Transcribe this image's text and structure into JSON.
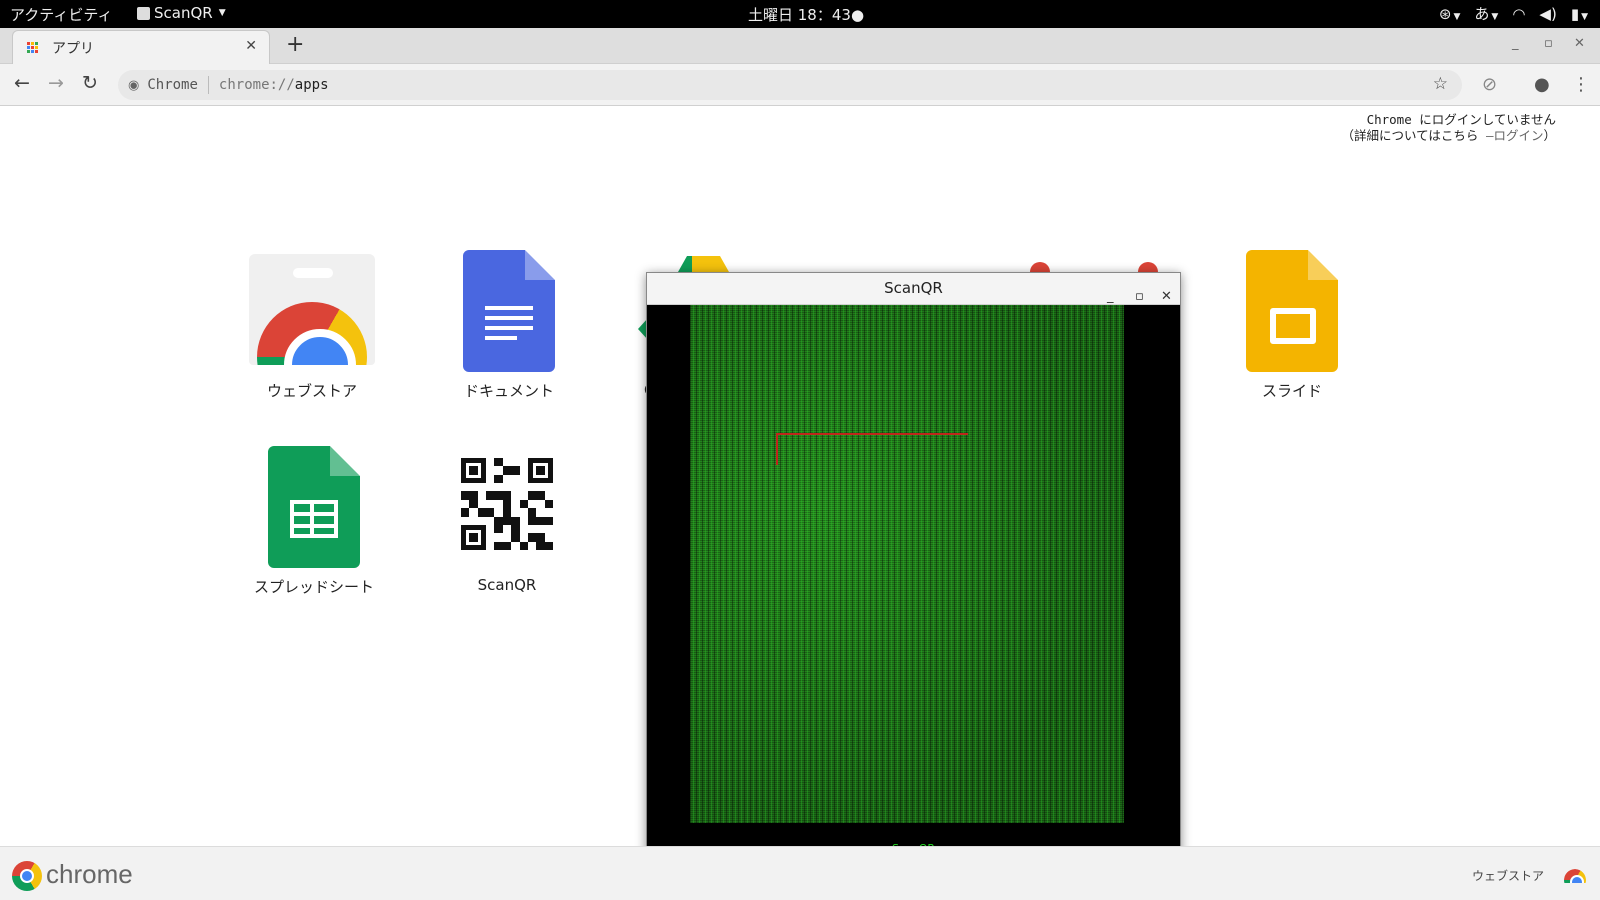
{
  "system": {
    "activities": "アクティビティ",
    "app_menu": "ScanQR",
    "clock": "土曜日 18：43●",
    "input_method": "あ",
    "icons": [
      "accessibility-icon",
      "wifi-icon",
      "volume-icon",
      "battery-icon"
    ]
  },
  "browser": {
    "tab_title": "アプリ",
    "omnibox_site": "Chrome",
    "url_scheme": "chrome://",
    "url_host": "apps",
    "login_line1": "Chrome にログインしていません",
    "login_line2_prefix": "（詳細についてはこちら ",
    "login_link": "—ログイン",
    "login_line2_suffix": "）"
  },
  "apps": [
    {
      "label": "ウェブストア",
      "icon": "webstore-icon"
    },
    {
      "label": "ドキュメント",
      "icon": "docs-icon"
    },
    {
      "label": "スライド",
      "icon": "slides-icon"
    },
    {
      "label": "スプレッドシート",
      "icon": "sheets-icon"
    },
    {
      "label": "ScanQR",
      "icon": "qr-icon"
    }
  ],
  "partial_label": "G",
  "scanqr": {
    "title": "ScanQR",
    "footer": "ScanQR"
  },
  "bottombar": {
    "brand": "chrome",
    "webstore_link": "ウェブストア"
  },
  "colors": {
    "docs_blue": "#4a67e0",
    "sheets_green": "#0f9d58",
    "slides_yellow": "#f4b400",
    "scan_green": "#1a5b16",
    "scan_red": "#c0261c"
  }
}
